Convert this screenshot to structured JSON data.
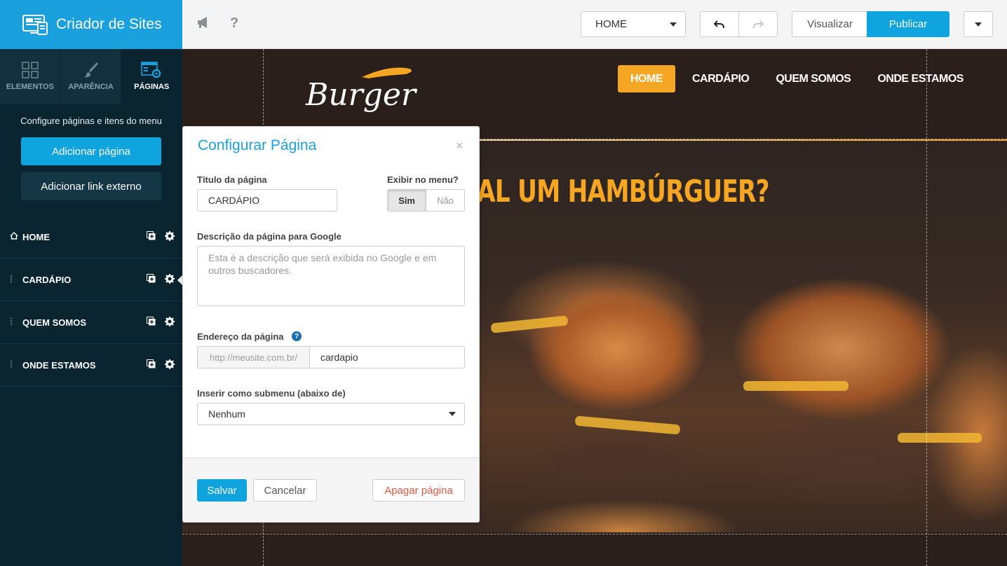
{
  "app": {
    "brand_label": "Criador de Sites",
    "accent_color": "#1aa0dc"
  },
  "topbar": {
    "page_select_value": "HOME",
    "visualizar_label": "Visualizar",
    "publicar_label": "Publicar",
    "icons": [
      "megaphone-icon",
      "help-icon",
      "undo-icon",
      "redo-icon",
      "caret-down-icon"
    ]
  },
  "sidebar": {
    "tabs": [
      {
        "label": "ELEMENTOS",
        "icon": "grid-icon",
        "active": false
      },
      {
        "label": "APARÊNCIA",
        "icon": "brush-icon",
        "active": false
      },
      {
        "label": "PÁGINAS",
        "icon": "pages-settings-icon",
        "active": true
      }
    ],
    "description": "Configure páginas e itens do menu",
    "add_page_label": "Adicionar página",
    "add_external_link_label": "Adicionar link externo",
    "pages": [
      {
        "label": "HOME",
        "lead_icon": "home-icon"
      },
      {
        "label": "CARDÁPIO",
        "lead_icon": "drag-handle-icon",
        "active": true
      },
      {
        "label": "QUEM SOMOS",
        "lead_icon": "drag-handle-icon"
      },
      {
        "label": "ONDE ESTAMOS",
        "lead_icon": "drag-handle-icon"
      }
    ]
  },
  "preview": {
    "logo_text": "Burger",
    "nav": [
      "HOME",
      "CARDÁPIO",
      "QUEM SOMOS",
      "ONDE ESTAMOS"
    ],
    "headline": "TAL UM HAMBÚRGUER?",
    "nav_active_color": "#f5a623"
  },
  "modal": {
    "title": "Configurar Página",
    "close": "×",
    "title_label": "Título da página",
    "title_value": "CARDÁPIO",
    "show_in_menu_label": "Exibir no menu?",
    "toggle_yes": "Sim",
    "toggle_no": "Não",
    "description_label": "Descrição da página para Google",
    "description_placeholder": "Esta é a descrição que será exibida no Google e em outros buscadores.",
    "address_label": "Endereço da página",
    "address_prefix": "http://meusite.com.br/",
    "address_value": "cardapio",
    "submenu_label": "Inserir como submenu (abaixo de)",
    "submenu_value": "Nenhum",
    "save_label": "Salvar",
    "cancel_label": "Cancelar",
    "delete_label": "Apagar página",
    "delete_color": "#e2563e"
  }
}
